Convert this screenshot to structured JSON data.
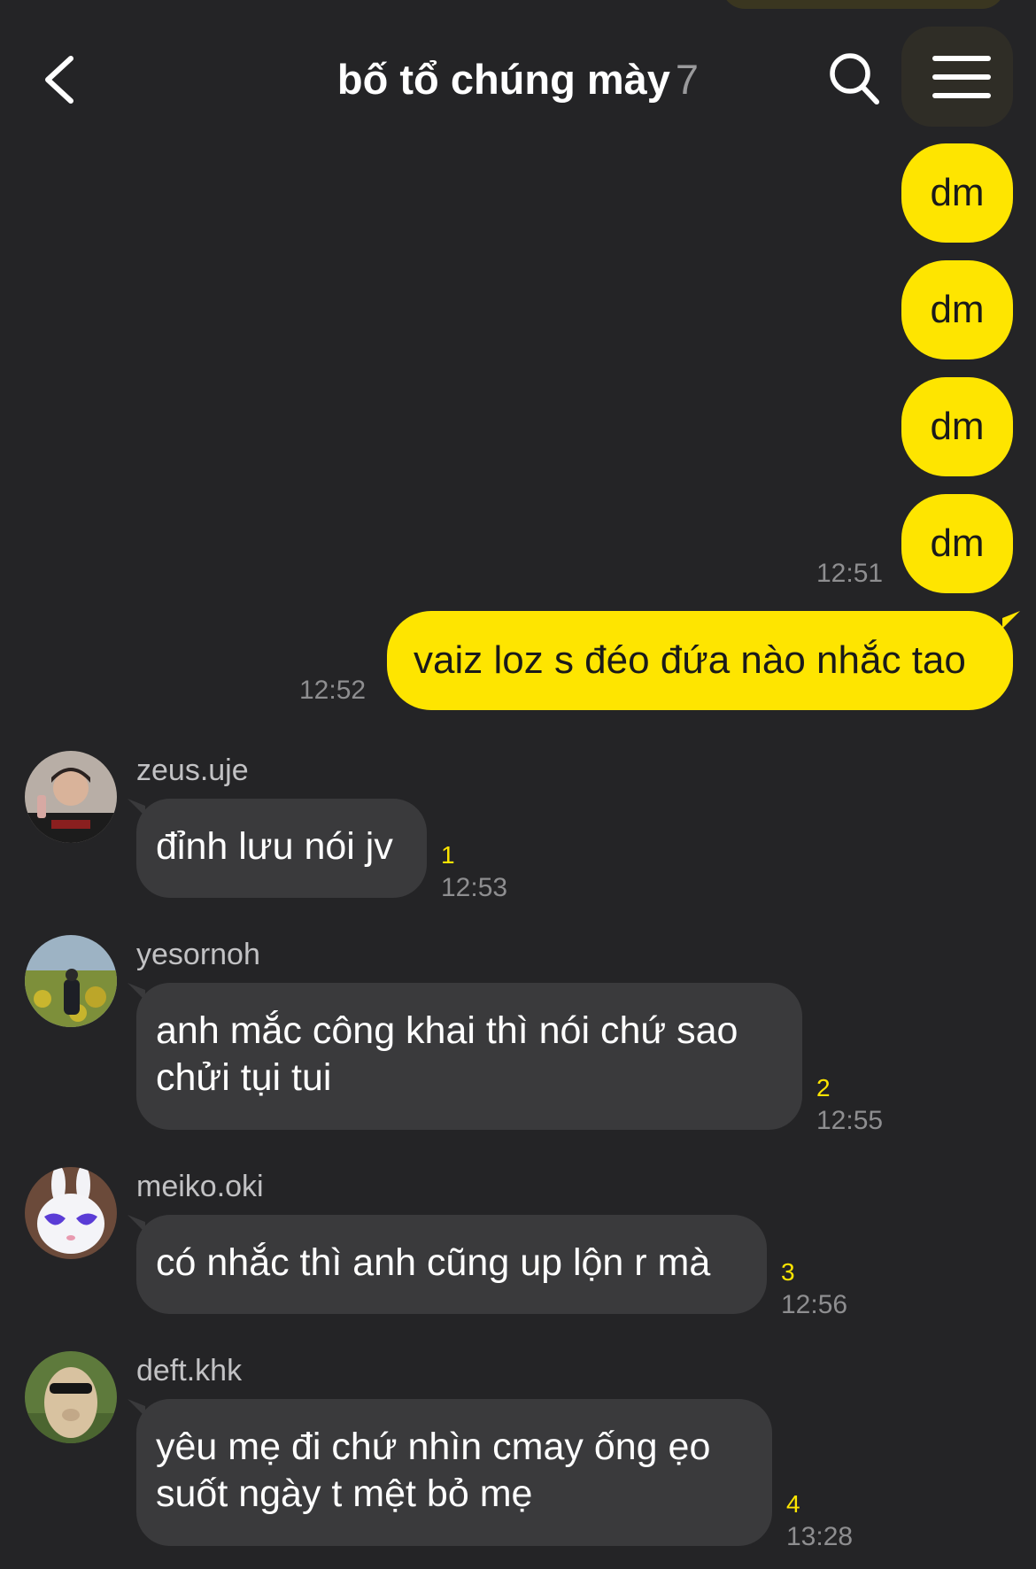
{
  "header": {
    "title": "bố tổ chúng mày",
    "member_count": "7"
  },
  "outgoing": [
    {
      "text": "dm",
      "time": ""
    },
    {
      "text": "dm",
      "time": ""
    },
    {
      "text": "dm",
      "time": ""
    },
    {
      "text": "dm",
      "time": "12:51"
    },
    {
      "text": "vaiz loz s đéo đứa nào nhắc tao",
      "time": "12:52"
    }
  ],
  "incoming": [
    {
      "sender": "zeus.uje",
      "text": "đỉnh lưu nói jv",
      "unread": "1",
      "time": "12:53"
    },
    {
      "sender": "yesornoh",
      "line1": "anh mắc công khai thì nói chứ sao",
      "line2": "chửi tụi tui",
      "unread": "2",
      "time": "12:55"
    },
    {
      "sender": "meiko.oki",
      "text": "có nhắc thì anh cũng up lộn r mà",
      "unread": "3",
      "time": "12:56"
    },
    {
      "sender": "deft.khk",
      "line1": "yêu mẹ đi chứ nhìn cmay ống ẹo",
      "line2": "suốt ngày t mệt bỏ mẹ",
      "unread": "4",
      "time": "13:28"
    }
  ],
  "colors": {
    "background": "#242426",
    "outgoing_bubble": "#fee500",
    "incoming_bubble": "#3a3a3c",
    "unread_count": "#fee500"
  },
  "icons": [
    "back-arrow-icon",
    "search-icon",
    "hamburger-menu-icon"
  ]
}
